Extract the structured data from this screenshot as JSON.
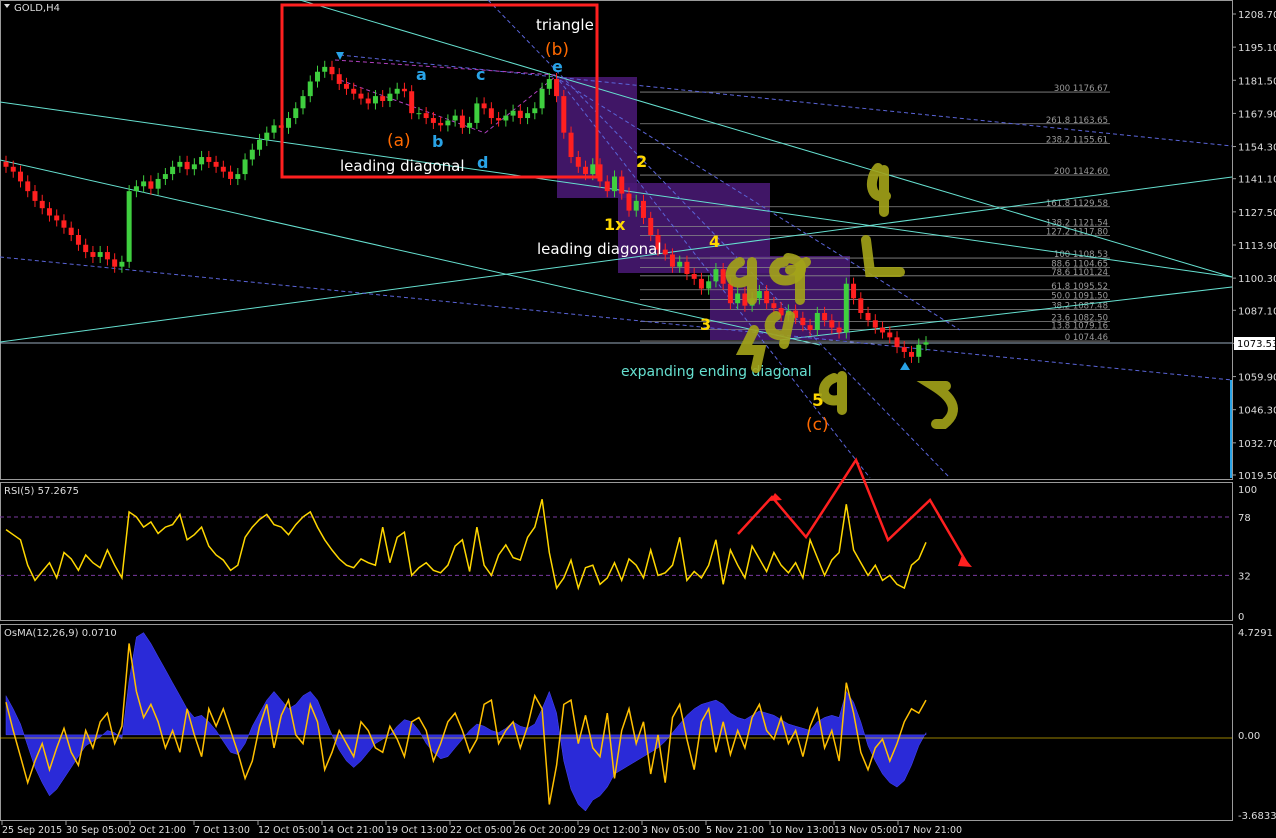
{
  "window": {
    "symbol_title": "GOLD,H4"
  },
  "colors": {
    "background": "#000000",
    "bull_candle": "#3fcf3f",
    "bear_candle": "#ff2020",
    "rsi_line": "#ffd700",
    "osma_fill": "#2a2ad8",
    "osma_signal": "#ffc000",
    "box_red": "#ff2020",
    "wave_blue": "#29a3e6",
    "wave_orange": "#ff6a00",
    "wave_yellow": "#ffd700",
    "channel_cyan": "#66e0d0",
    "fib_gray": "#8a8a8a",
    "purple_zone": "#4b1a78",
    "annotation_olive": "#a3a318"
  },
  "main_panel": {
    "price_axis_ticks": [
      "1208.70",
      "1195.10",
      "1181.50",
      "1167.90",
      "1154.30",
      "1141.10",
      "1127.50",
      "1113.90",
      "1100.30",
      "1087.10",
      "1073.53",
      "1059.90",
      "1046.30",
      "1032.70",
      "1019.50"
    ],
    "current_price": "1073.53",
    "fib_levels": [
      {
        "label": "300  1176.67",
        "value": 1176.67
      },
      {
        "label": "261.8  1163.65",
        "value": 1163.65
      },
      {
        "label": "238.2  1155.61",
        "value": 1155.61
      },
      {
        "label": "200  1142.60",
        "value": 1142.6
      },
      {
        "label": "161.8  1129.58",
        "value": 1129.58
      },
      {
        "label": "138.2  1121.54",
        "value": 1121.54
      },
      {
        "label": "127.2  1117.80",
        "value": 1117.8
      },
      {
        "label": "100  1108.53",
        "value": 1108.53
      },
      {
        "label": "88.6  1104.65",
        "value": 1104.65
      },
      {
        "label": "78.6  1101.24",
        "value": 1101.24
      },
      {
        "label": "61.8  1095.52",
        "value": 1095.52
      },
      {
        "label": "50.0  1091.50",
        "value": 1091.5
      },
      {
        "label": "38.2  1087.48",
        "value": 1087.48
      },
      {
        "label": "23.6  1082.50",
        "value": 1082.5
      },
      {
        "label": "13.8  1079.16",
        "value": 1079.16
      },
      {
        "label": "0  1074.46",
        "value": 1074.46
      }
    ],
    "annotations": {
      "triangle": "triangle",
      "wave_b": "(b)",
      "wave_a": "(a)",
      "wave_c": "(c)",
      "leading_diagonal_1": "leading diagonal",
      "leading_diagonal_2": "leading diagonal",
      "expanding_ending_diagonal": "expanding ending diagonal",
      "lbl_a": "a",
      "lbl_b": "b",
      "lbl_c": "c",
      "lbl_d": "d",
      "lbl_e": "e",
      "lbl_1x": "1x",
      "lbl_2": "2",
      "lbl_3": "3",
      "lbl_4": "4",
      "lbl_5": "5",
      "hand_4": "4",
      "hand_5": "5"
    }
  },
  "rsi_panel": {
    "title": "RSI(5) 57.2675",
    "levels": [
      "100",
      "78",
      "32",
      "0"
    ]
  },
  "osma_panel": {
    "title": "OsMA(12,26,9) 0.0710",
    "ticks": [
      "4.7291",
      "0.00",
      "-3.6833"
    ]
  },
  "time_axis": [
    "25 Sep 2015",
    "30 Sep 05:00",
    "2 Oct 21:00",
    "7 Oct 13:00",
    "12 Oct 05:00",
    "14 Oct 21:00",
    "19 Oct 13:00",
    "22 Oct 05:00",
    "26 Oct 20:00",
    "29 Oct 12:00",
    "3 Nov 05:00",
    "5 Nov 21:00",
    "10 Nov 13:00",
    "13 Nov 05:00",
    "17 Nov 21:00"
  ],
  "chart_data": {
    "type": "candlestick",
    "symbol": "GOLD,H4",
    "closes": [
      1146,
      1144,
      1140,
      1136,
      1132,
      1129,
      1126,
      1124,
      1121,
      1118,
      1114,
      1111,
      1109,
      1111,
      1108,
      1105,
      1107,
      1136,
      1138,
      1140,
      1137,
      1141,
      1143,
      1146,
      1148,
      1145,
      1147,
      1150,
      1148,
      1146,
      1144,
      1141,
      1143,
      1149,
      1153,
      1157,
      1160,
      1163,
      1162,
      1166,
      1170,
      1175,
      1181,
      1185,
      1187,
      1184,
      1180,
      1178,
      1176,
      1174,
      1172,
      1175,
      1173,
      1176,
      1178,
      1177,
      1168,
      1168,
      1166,
      1164,
      1163,
      1165,
      1167,
      1162,
      1164,
      1172,
      1170,
      1166,
      1165,
      1167,
      1169,
      1166,
      1168,
      1170,
      1178,
      1182,
      1175,
      1160,
      1150,
      1146,
      1143,
      1147,
      1140,
      1136,
      1142,
      1135,
      1128,
      1132,
      1125,
      1118,
      1112,
      1110,
      1105,
      1107,
      1102,
      1100,
      1096,
      1099,
      1104,
      1098,
      1090,
      1094,
      1089,
      1092,
      1095,
      1090,
      1088,
      1085,
      1087,
      1084,
      1081,
      1079,
      1086,
      1083,
      1080,
      1078,
      1098,
      1092,
      1086,
      1083,
      1080,
      1078,
      1076,
      1072,
      1070,
      1068,
      1073,
      1074
    ],
    "rsi": [
      68,
      64,
      60,
      40,
      28,
      35,
      42,
      30,
      50,
      45,
      36,
      48,
      42,
      38,
      52,
      40,
      30,
      82,
      78,
      70,
      74,
      65,
      70,
      72,
      80,
      60,
      64,
      70,
      55,
      48,
      44,
      36,
      40,
      62,
      70,
      76,
      80,
      72,
      70,
      64,
      72,
      78,
      82,
      70,
      60,
      52,
      45,
      40,
      38,
      45,
      42,
      40,
      70,
      42,
      62,
      66,
      32,
      38,
      42,
      36,
      34,
      40,
      55,
      60,
      35,
      70,
      40,
      32,
      48,
      56,
      46,
      44,
      62,
      70,
      92,
      50,
      22,
      30,
      44,
      22,
      38,
      40,
      25,
      30,
      42,
      28,
      45,
      40,
      30,
      52,
      32,
      34,
      40,
      62,
      28,
      35,
      30,
      40,
      60,
      25,
      52,
      40,
      30,
      55,
      45,
      35,
      50,
      40,
      34,
      42,
      30,
      60,
      46,
      32,
      44,
      50,
      88,
      52,
      42,
      32,
      40,
      28,
      32,
      25,
      22,
      40,
      45,
      58
    ],
    "osma_hist": [
      1.8,
      1.2,
      0.5,
      -0.5,
      -1.5,
      -2.2,
      -2.8,
      -2.5,
      -2.0,
      -1.5,
      -1.0,
      -0.5,
      -0.3,
      -0.1,
      0.2,
      0.1,
      -0.2,
      2.5,
      4.5,
      4.7,
      4.2,
      3.6,
      3.0,
      2.4,
      1.8,
      1.2,
      0.8,
      0.9,
      0.6,
      0.2,
      -0.3,
      -0.8,
      -0.9,
      -0.4,
      0.4,
      1.0,
      1.6,
      2.0,
      1.6,
      1.2,
      1.4,
      1.8,
      2.0,
      1.6,
      0.8,
      0.0,
      -0.7,
      -1.2,
      -1.5,
      -1.2,
      -0.8,
      -0.4,
      -0.2,
      0.0,
      0.4,
      0.7,
      0.6,
      0.2,
      -0.4,
      -0.8,
      -1.1,
      -1.0,
      -0.6,
      -0.2,
      0.2,
      0.5,
      0.4,
      0.2,
      0.1,
      0.3,
      0.6,
      0.4,
      0.3,
      0.5,
      1.2,
      2.0,
      1.0,
      -1.2,
      -2.5,
      -3.2,
      -3.5,
      -3.0,
      -2.8,
      -2.4,
      -1.8,
      -1.6,
      -1.4,
      -1.2,
      -1.0,
      -0.8,
      -0.6,
      -0.3,
      0.1,
      0.5,
      0.9,
      1.2,
      1.4,
      1.5,
      1.6,
      1.4,
      1.0,
      0.8,
      0.7,
      0.9,
      1.1,
      1.0,
      0.9,
      0.7,
      0.5,
      0.4,
      0.3,
      0.2,
      0.6,
      0.8,
      0.9,
      0.8,
      2.0,
      1.5,
      0.6,
      -0.5,
      -1.2,
      -1.8,
      -2.2,
      -2.4,
      -2.1,
      -1.4,
      -0.5,
      0.1
    ],
    "osma_signal": [
      1.5,
      0.2,
      -1.0,
      -2.2,
      -1.2,
      -0.4,
      -1.6,
      -0.6,
      0.3,
      -0.8,
      -1.4,
      0.2,
      -0.6,
      0.6,
      1.0,
      -0.4,
      0.4,
      4.2,
      2.0,
      0.8,
      1.4,
      0.6,
      -0.6,
      0.2,
      -0.8,
      1.2,
      0.0,
      -1.0,
      1.2,
      0.4,
      1.2,
      0.2,
      -0.8,
      -2.0,
      -1.2,
      0.4,
      1.4,
      -0.6,
      0.9,
      1.6,
      0.0,
      -0.4,
      1.4,
      0.6,
      -1.6,
      -0.8,
      0.2,
      -0.4,
      -1.0,
      0.6,
      0.2,
      -0.6,
      -0.8,
      0.4,
      -0.2,
      -1.0,
      0.6,
      0.8,
      0.2,
      -1.2,
      -0.4,
      0.6,
      1.0,
      0.2,
      -0.8,
      -0.2,
      1.4,
      1.6,
      -0.4,
      0.2,
      0.6,
      -0.6,
      0.4,
      1.8,
      1.2,
      -3.2,
      -1.4,
      1.4,
      1.6,
      -0.4,
      0.9,
      -0.6,
      -1.0,
      1.0,
      -2.0,
      0.2,
      1.2,
      -0.4,
      0.6,
      -1.8,
      0.0,
      -2.2,
      0.8,
      1.4,
      -0.2,
      -1.6,
      0.6,
      1.2,
      -0.8,
      0.6,
      -0.9,
      0.2,
      -0.6,
      0.8,
      1.4,
      0.2,
      -0.2,
      0.8,
      -0.4,
      0.2,
      -1.0,
      0.4,
      1.2,
      -0.6,
      0.2,
      -1.2,
      2.4,
      1.0,
      -0.8,
      -1.6,
      -0.6,
      -0.2,
      -1.2,
      -0.4,
      0.6,
      1.2,
      1.0,
      1.6
    ]
  }
}
